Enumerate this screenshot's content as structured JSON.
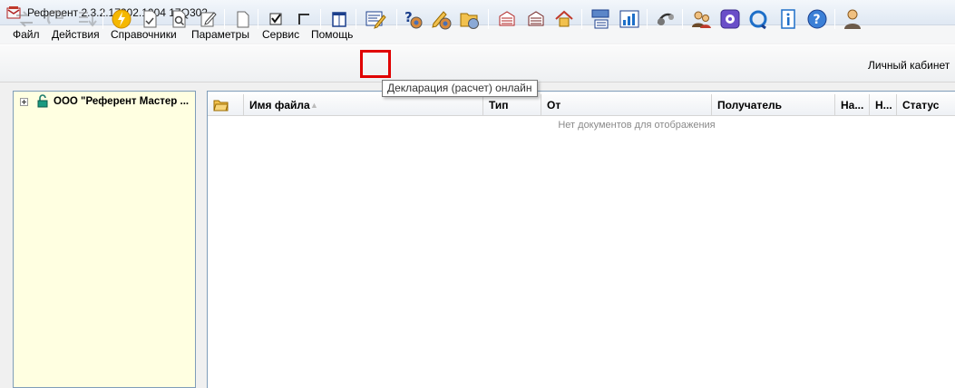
{
  "window": {
    "title": "Референт 2.3.2.17302.1004 17Q302"
  },
  "menu": [
    "Файл",
    "Действия",
    "Справочники",
    "Параметры",
    "Сервис",
    "Помощь"
  ],
  "toolbar": {
    "highlighted_tooltip": "Декларация (расчет) онлайн",
    "cabinet_label": "Личный кабинет"
  },
  "tree": {
    "root_label": "ООО \"Референт Мастер ..."
  },
  "grid": {
    "columns": [
      "Имя файла",
      "Тип",
      "От",
      "Получатель",
      "На...",
      "Н...",
      "Статус"
    ],
    "empty_message": "Нет документов для отображения"
  },
  "colors": {
    "highlight": "#e00000",
    "tree_bg": "#ffffe1",
    "accent": "#1e6fc8"
  }
}
